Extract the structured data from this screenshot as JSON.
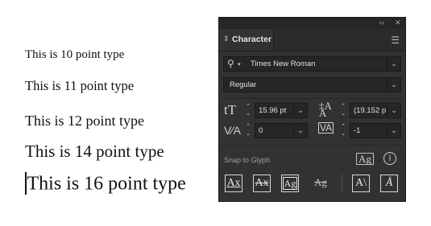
{
  "samples": {
    "s10": "This is 10 point type",
    "s11": "This is 11 point type",
    "s12": "This is 12 point type",
    "s14": "This is 14 point type",
    "s16": "This is 16 point type"
  },
  "panel": {
    "title": "Character",
    "font_family": "Times New Roman",
    "font_style": "Regular",
    "font_size": "15.96 pt",
    "leading": "(19.152 p",
    "kerning": "0",
    "tracking": "-1",
    "snap_label": "Snap to Glyph"
  },
  "icons": {
    "collapse": "collapse-icon",
    "close": "close-icon",
    "menu": "panel-menu-icon"
  }
}
